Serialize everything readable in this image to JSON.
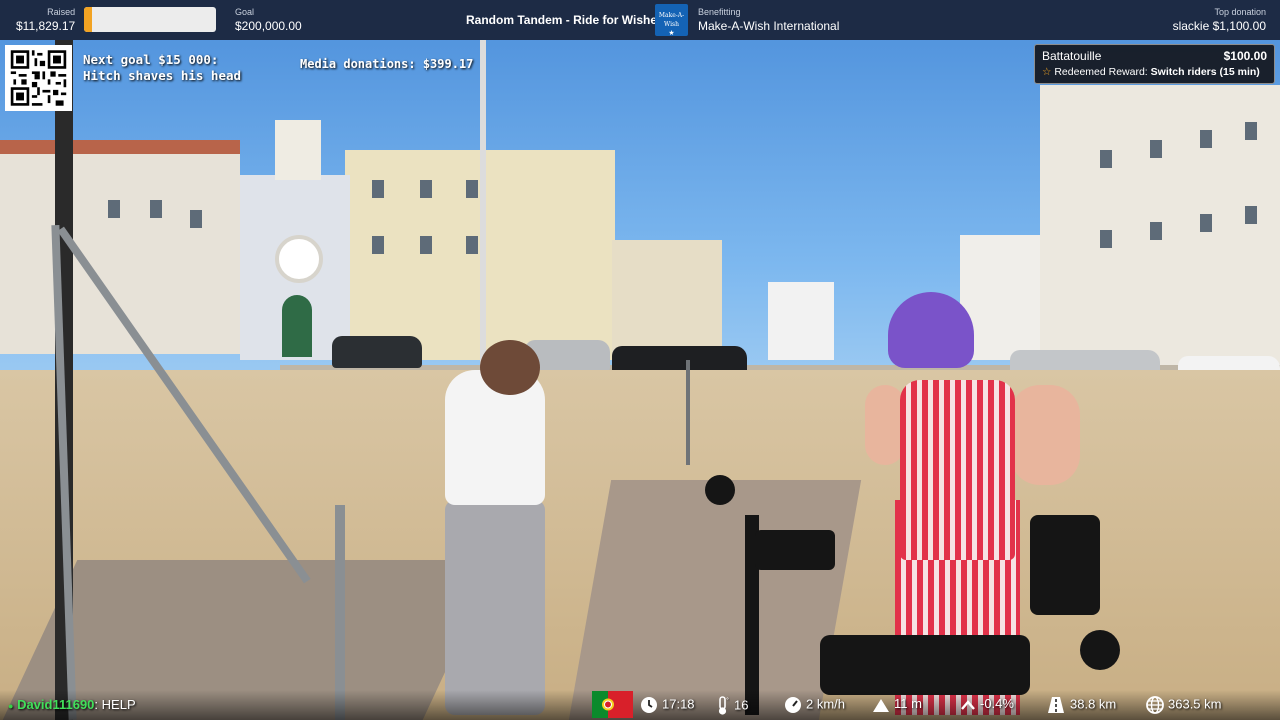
{
  "topbar": {
    "raised": {
      "label": "Raised",
      "value": "$11,829.17"
    },
    "goal": {
      "label": "Goal",
      "value": "$200,000.00"
    },
    "progress_fraction": 0.059,
    "title": "Random Tandem - Ride for Wishes",
    "logo_text": "Make-A-Wish",
    "benefitting": {
      "label": "Benefitting",
      "value": "Make-A-Wish International"
    },
    "top_donation": {
      "label": "Top donation",
      "value": "slackie $1,100.00"
    }
  },
  "overlay": {
    "next_goal": "Next goal $15 000: Hitch shaves his head",
    "media_donations": "Media donations: $399.17"
  },
  "alert": {
    "user": "Battatouille",
    "amount": "$100.00",
    "prefix": "Redeemed Reward:",
    "reward": "Switch riders (15 min)"
  },
  "chat": {
    "user": "David111690",
    "message": "HELP"
  },
  "telemetry": {
    "time": "17:18",
    "temperature": "16",
    "speed": "2 km/h",
    "altitude": "11 m",
    "grade": "-0.4%",
    "trip_distance": "38.8 km",
    "total_distance": "363.5 km"
  },
  "icons": {
    "flag": "portugal-flag-icon",
    "time": "clock-icon",
    "temperature": "thermometer-icon",
    "speed": "speedometer-icon",
    "altitude": "mountain-icon",
    "grade": "chevron-up-icon",
    "trip": "road-icon",
    "total": "globe-icon"
  },
  "colors": {
    "topbar_bg": "#1d2b45",
    "progress_fill": "#f2a323",
    "chat_user": "#41e05a",
    "reward_star": "#f5a623"
  }
}
